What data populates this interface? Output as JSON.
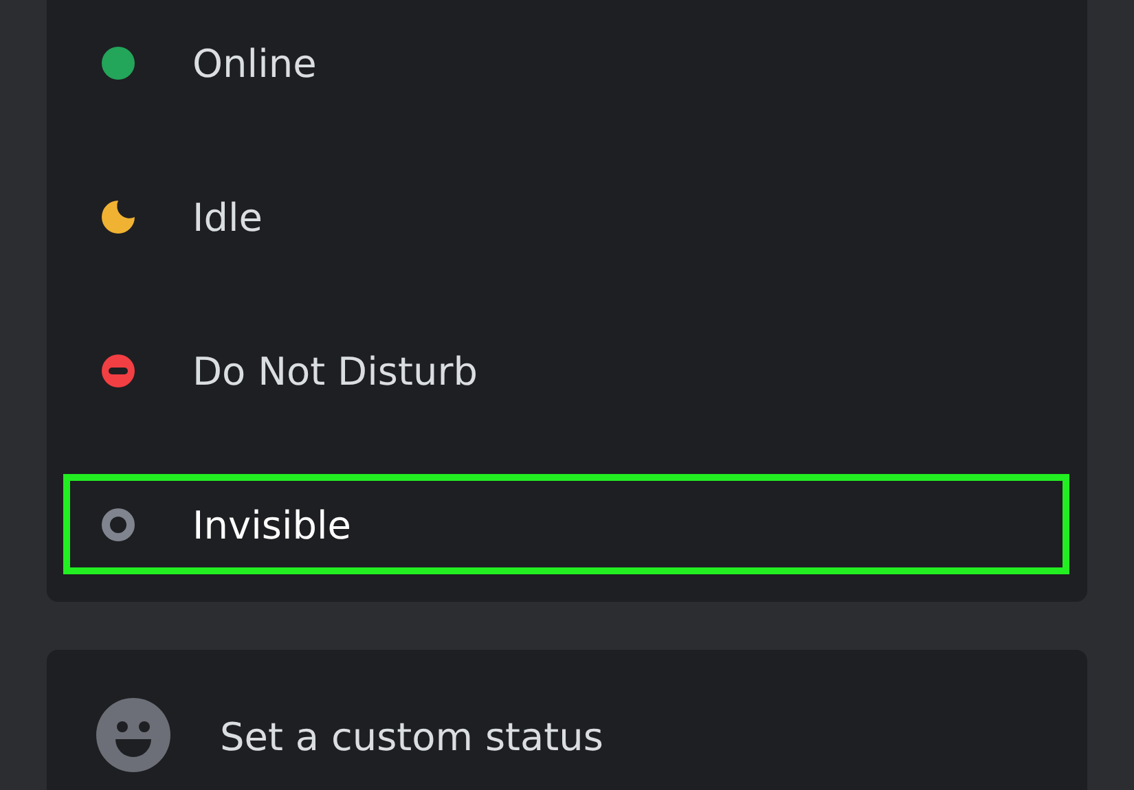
{
  "statuses": [
    {
      "label": "Online",
      "kind": "dot",
      "color": "#23a55a",
      "highlighted": false
    },
    {
      "label": "Idle",
      "kind": "moon",
      "color": "#f0b232",
      "highlighted": false
    },
    {
      "label": "Do Not Disturb",
      "kind": "minus",
      "color": "#f23f43",
      "highlighted": false
    },
    {
      "label": "Invisible",
      "kind": "ring",
      "color": "#80848e",
      "highlighted": true
    }
  ],
  "custom_status": {
    "label": "Set a custom status"
  }
}
